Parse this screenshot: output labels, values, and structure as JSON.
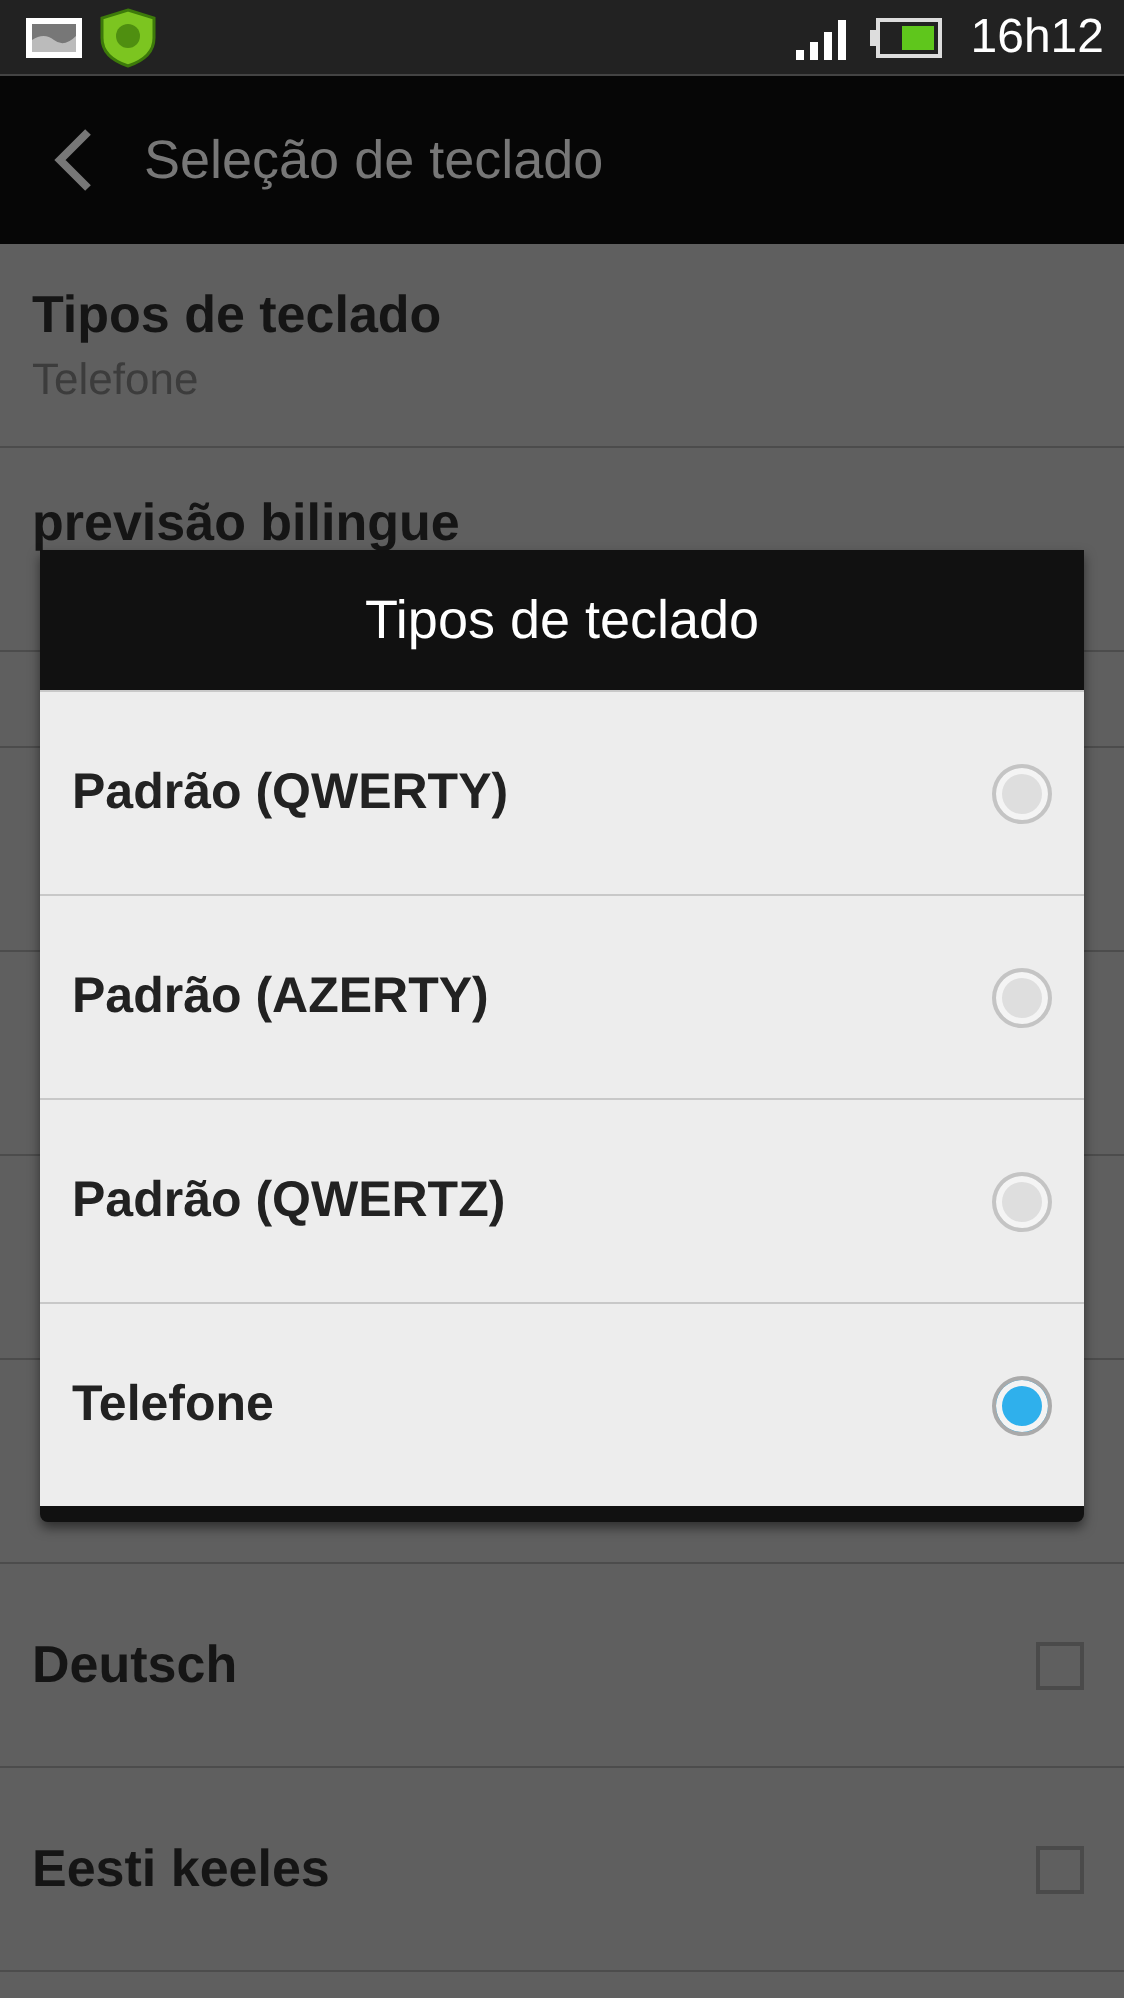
{
  "status_bar": {
    "time": "16h12"
  },
  "action_bar": {
    "title": "Seleção de teclado"
  },
  "settings": [
    {
      "kind": "summary",
      "title": "Tipos de teclado",
      "summary": "Telefone"
    },
    {
      "kind": "title",
      "title": "previsão bilingue"
    },
    {
      "kind": "hidden"
    },
    {
      "kind": "hidden"
    },
    {
      "kind": "hidden"
    },
    {
      "kind": "hidden"
    },
    {
      "kind": "hidden"
    },
    {
      "kind": "checkbox",
      "title": "Deutsch",
      "checked": false
    },
    {
      "kind": "checkbox",
      "title": "Eesti keeles",
      "checked": false
    }
  ],
  "dialog": {
    "title": "Tipos de teclado",
    "options": [
      {
        "label": "Padrão (QWERTY)",
        "selected": false
      },
      {
        "label": "Padrão (AZERTY)",
        "selected": false
      },
      {
        "label": "Padrão (QWERTZ)",
        "selected": false
      },
      {
        "label": "Telefone",
        "selected": true
      }
    ]
  }
}
